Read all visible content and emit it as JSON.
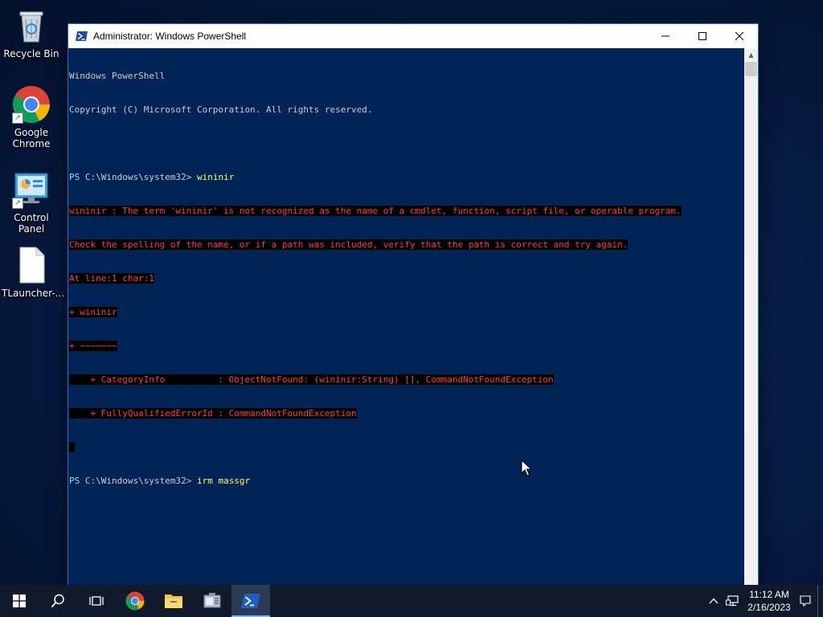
{
  "desktop": {
    "icons": [
      {
        "label": "Recycle Bin"
      },
      {
        "label": "Google Chrome"
      },
      {
        "label": "Control Panel"
      },
      {
        "label": "TLauncher-..."
      }
    ]
  },
  "window": {
    "title": "Administrator: Windows PowerShell",
    "controls": {
      "minimize": "minimize",
      "maximize": "maximize",
      "close": "close"
    }
  },
  "console": {
    "lines": [
      {
        "type": "normal",
        "text": "Windows PowerShell"
      },
      {
        "type": "normal",
        "text": "Copyright (C) Microsoft Corporation. All rights reserved."
      },
      {
        "type": "blank",
        "text": ""
      },
      {
        "type": "prompt",
        "prompt": "PS C:\\Windows\\system32> ",
        "command": "wininir"
      },
      {
        "type": "error",
        "text": "wininir : The term 'wininir' is not recognized as the name of a cmdlet, function, script file, or operable program."
      },
      {
        "type": "error",
        "text": "Check the spelling of the name, or if a path was included, verify that the path is correct and try again."
      },
      {
        "type": "error",
        "text": "At line:1 char:1"
      },
      {
        "type": "error",
        "text": "+ wininir"
      },
      {
        "type": "error",
        "text": "+ ~~~~~~~"
      },
      {
        "type": "error",
        "text": "    + CategoryInfo          : ObjectNotFound: (wininir:String) [], CommandNotFoundException"
      },
      {
        "type": "error",
        "text": "    + FullyQualifiedErrorId : CommandNotFoundException"
      },
      {
        "type": "error",
        "text": " "
      },
      {
        "type": "prompt",
        "prompt": "PS C:\\Windows\\system32> ",
        "command": "irm massgr"
      }
    ]
  },
  "taskbar": {
    "items": [
      "start-icon",
      "search-icon",
      "task-view-icon",
      "chrome-icon",
      "file-explorer-icon",
      "server-manager-icon",
      "powershell-icon"
    ],
    "active": "powershell-icon",
    "clock": {
      "time": "11:12 AM",
      "date": "2/16/2023"
    }
  },
  "colors": {
    "console_bg": "#012456",
    "console_text": "#cccccc",
    "error_text": "#ff3b3b",
    "command_text": "#ffff60",
    "taskbar_bg": "#101a2b"
  }
}
